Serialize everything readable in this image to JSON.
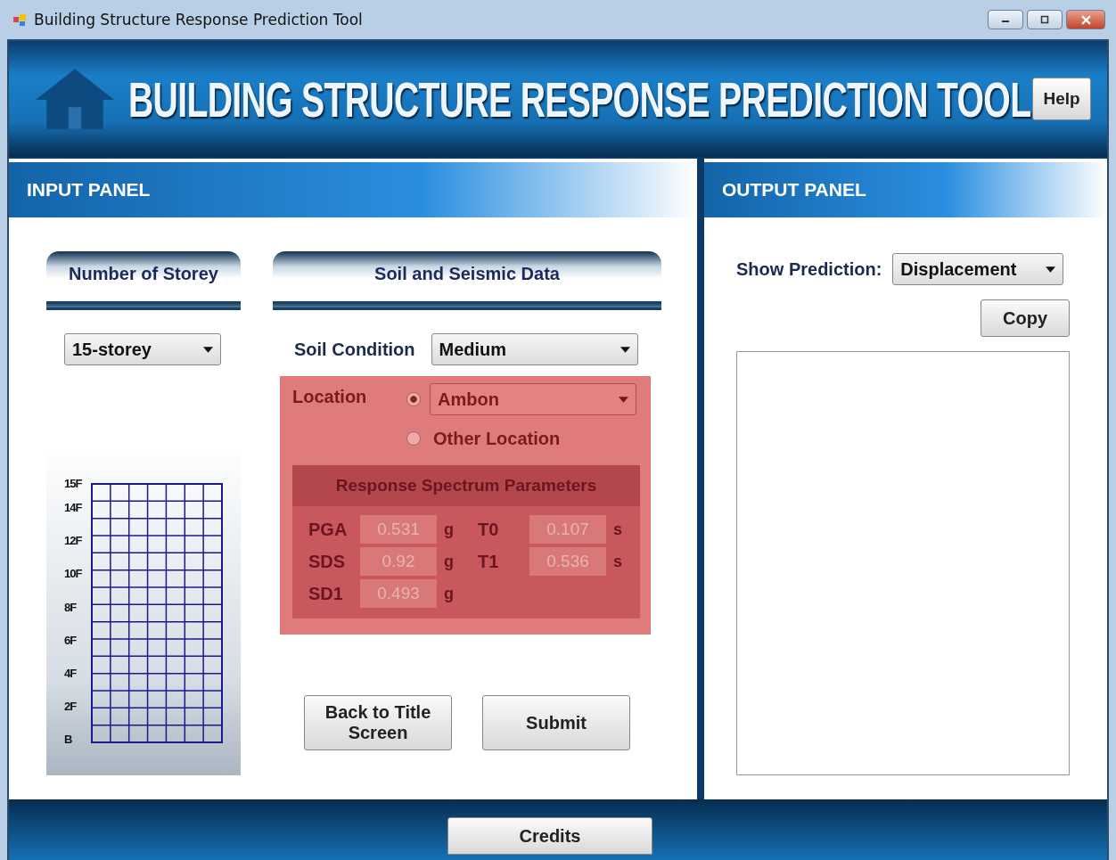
{
  "window": {
    "title": "Building Structure Response Prediction Tool"
  },
  "header": {
    "title": "BUILDING STRUCTURE RESPONSE PREDICTION TOOL",
    "help_button": "Help"
  },
  "input_panel": {
    "title": "INPUT PANEL",
    "storey": {
      "heading": "Number of Storey",
      "value": "15-storey",
      "floor_labels": [
        "15F",
        "14F",
        "12F",
        "10F",
        "8F",
        "6F",
        "4F",
        "2F",
        "B"
      ]
    },
    "soil": {
      "heading": "Soil and Seismic Data",
      "soil_label": "Soil Condition",
      "soil_value": "Medium",
      "location_label": "Location",
      "location_options": [
        {
          "kind": "dropdown",
          "value": "Ambon",
          "selected": true
        },
        {
          "kind": "text",
          "label": "Other Location",
          "selected": false
        }
      ],
      "spectrum_title": "Response Spectrum Parameters",
      "params": [
        {
          "label": "PGA",
          "value": "0.531",
          "unit": "g"
        },
        {
          "label": "T0",
          "value": "0.107",
          "unit": "s"
        },
        {
          "label": "SDS",
          "value": "0.92",
          "unit": "g"
        },
        {
          "label": "T1",
          "value": "0.536",
          "unit": "s"
        },
        {
          "label": "SD1",
          "value": "0.493",
          "unit": "g"
        }
      ]
    },
    "buttons": [
      "Back to Title Screen",
      "Submit"
    ]
  },
  "output_panel": {
    "title": "OUTPUT PANEL",
    "show_label": "Show Prediction:",
    "show_value": "Displacement",
    "copy_button": "Copy"
  },
  "footer": {
    "button": "Credits"
  }
}
